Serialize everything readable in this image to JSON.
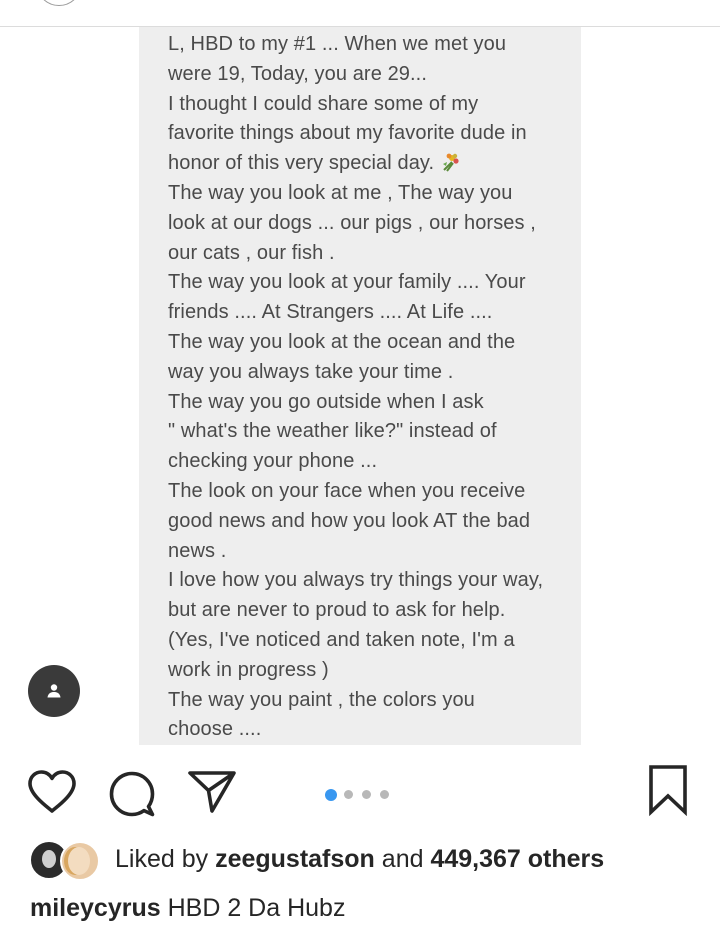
{
  "note": {
    "lines": [
      "L,  HBD to my #1 ... When we met you",
      "were 19,  Today, you are 29...",
      "I thought I could share some of my",
      "favorite things about my favorite dude in",
      "honor of this very special day.",
      "The way you look at me , The way you",
      "look at our dogs ... our pigs , our horses ,",
      "our cats ,  our fish .",
      "The way you look at your family .... Your",
      "friends .... At Strangers ....  At Life ....",
      "The way you look at the ocean and the",
      "way you always take your time .",
      "The way you go outside when I ask",
      "\" what's the weather like?\"  instead of",
      "checking your phone ...",
      "The look on your face when you receive",
      "good news and how you look AT the bad",
      "news .",
      "I love how you always try things your way,",
      "but are never to proud to ask for help.",
      "(Yes, I've noticed and taken note, I'm a",
      "work in progress )",
      "The way you paint , the colors you",
      "choose    ...."
    ],
    "emoji_icon": "bouquet-icon"
  },
  "actions": {
    "like_icon": "heart-icon",
    "comment_icon": "comment-bubble-icon",
    "share_icon": "paper-plane-icon",
    "save_icon": "bookmark-icon",
    "tag_icon": "user-icon"
  },
  "carousel": {
    "total": 4,
    "active_index": 0,
    "active_color": "#3897f0"
  },
  "likes": {
    "prefix": "Liked by",
    "user": "zeegustafson",
    "connector": "and",
    "count_text": "449,367 others"
  },
  "caption": {
    "username": "mileycyrus",
    "text": "HBD 2 Da Hubz"
  }
}
